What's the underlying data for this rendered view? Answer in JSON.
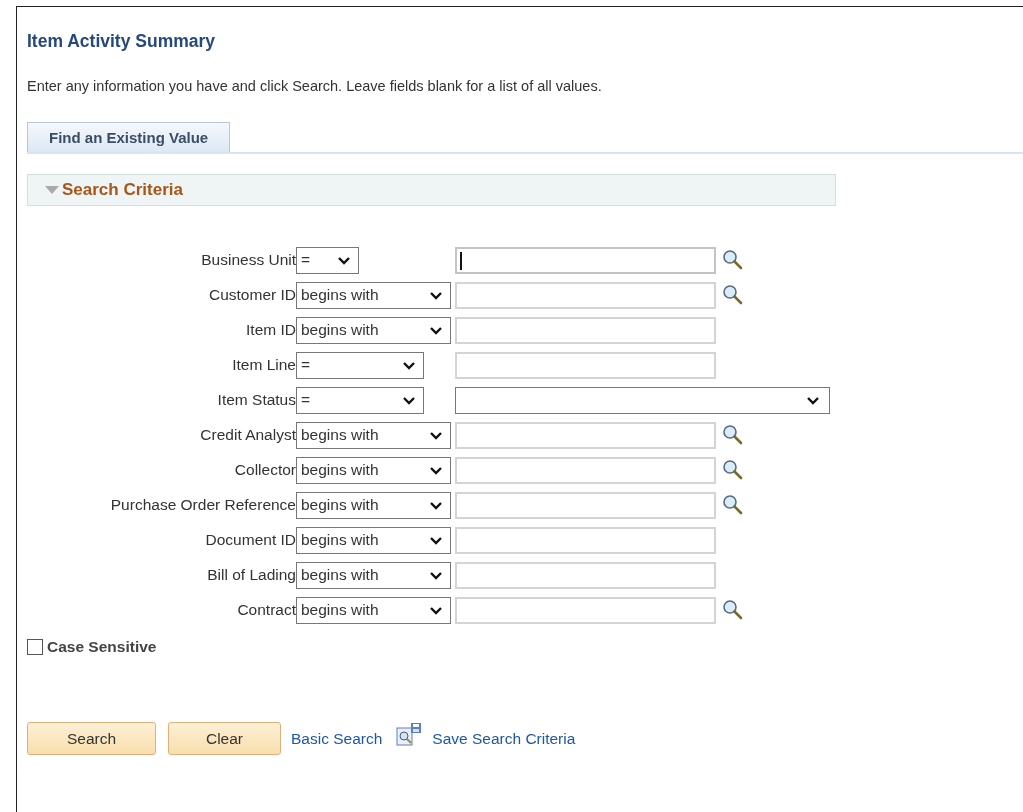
{
  "page": {
    "title": "Item Activity Summary",
    "instructions": "Enter any information you have and click Search. Leave fields blank for a list of all values."
  },
  "tabs": [
    {
      "label": "Find an Existing Value",
      "selected": true
    }
  ],
  "section": {
    "title": "Search Criteria",
    "expanded": true
  },
  "criteria": [
    {
      "label": "Business Unit",
      "operator": {
        "value": "=",
        "kind": "narrow"
      },
      "field": {
        "kind": "text",
        "focused": true,
        "lookup": true
      }
    },
    {
      "label": "Customer ID",
      "operator": {
        "value": "begins with",
        "kind": "wide"
      },
      "field": {
        "kind": "text",
        "focused": false,
        "lookup": true
      }
    },
    {
      "label": "Item ID",
      "operator": {
        "value": "begins with",
        "kind": "wide"
      },
      "field": {
        "kind": "text",
        "focused": false,
        "lookup": false
      }
    },
    {
      "label": "Item Line",
      "operator": {
        "value": "=",
        "kind": "medium"
      },
      "field": {
        "kind": "text",
        "focused": false,
        "lookup": false
      }
    },
    {
      "label": "Item Status",
      "operator": {
        "value": "=",
        "kind": "medium"
      },
      "field": {
        "kind": "dropdown",
        "focused": false,
        "lookup": false
      }
    },
    {
      "label": "Credit Analyst",
      "operator": {
        "value": "begins with",
        "kind": "wide"
      },
      "field": {
        "kind": "text",
        "focused": false,
        "lookup": true
      }
    },
    {
      "label": "Collector",
      "operator": {
        "value": "begins with",
        "kind": "wide"
      },
      "field": {
        "kind": "text",
        "focused": false,
        "lookup": true
      }
    },
    {
      "label": "Purchase Order Reference",
      "operator": {
        "value": "begins with",
        "kind": "wide"
      },
      "field": {
        "kind": "text",
        "focused": false,
        "lookup": true
      }
    },
    {
      "label": "Document ID",
      "operator": {
        "value": "begins with",
        "kind": "wide"
      },
      "field": {
        "kind": "text",
        "focused": false,
        "lookup": false
      }
    },
    {
      "label": "Bill of Lading",
      "operator": {
        "value": "begins with",
        "kind": "wide"
      },
      "field": {
        "kind": "text",
        "focused": false,
        "lookup": false
      }
    },
    {
      "label": "Contract",
      "operator": {
        "value": "begins with",
        "kind": "wide"
      },
      "field": {
        "kind": "text",
        "focused": false,
        "lookup": true
      }
    }
  ],
  "case_sensitive": {
    "label": "Case Sensitive",
    "checked": false
  },
  "buttons": [
    "Search",
    "Clear"
  ],
  "links": [
    {
      "label": "Basic Search",
      "icon": false
    },
    {
      "label": "Save Search Criteria",
      "icon": true
    }
  ]
}
